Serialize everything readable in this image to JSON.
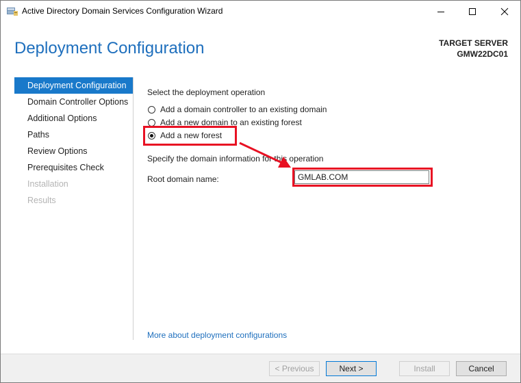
{
  "window": {
    "title": "Active Directory Domain Services Configuration Wizard"
  },
  "header": {
    "page_title": "Deployment Configuration",
    "target_label": "TARGET SERVER",
    "target_server": "GMW22DC01"
  },
  "sidebar": {
    "items": [
      {
        "label": "Deployment Configuration",
        "state": "active"
      },
      {
        "label": "Domain Controller Options",
        "state": "normal"
      },
      {
        "label": "Additional Options",
        "state": "normal"
      },
      {
        "label": "Paths",
        "state": "normal"
      },
      {
        "label": "Review Options",
        "state": "normal"
      },
      {
        "label": "Prerequisites Check",
        "state": "normal"
      },
      {
        "label": "Installation",
        "state": "disabled"
      },
      {
        "label": "Results",
        "state": "disabled"
      }
    ]
  },
  "main": {
    "operation_heading": "Select the deployment operation",
    "options": [
      {
        "label": "Add a domain controller to an existing domain",
        "checked": false
      },
      {
        "label": "Add a new domain to an existing forest",
        "checked": false
      },
      {
        "label": "Add a new forest",
        "checked": true
      }
    ],
    "domain_heading": "Specify the domain information for this operation",
    "root_domain_label": "Root domain name:",
    "root_domain_value": "GMLAB.COM",
    "more_link": "More about deployment configurations"
  },
  "footer": {
    "previous": "< Previous",
    "next": "Next >",
    "install": "Install",
    "cancel": "Cancel"
  },
  "colors": {
    "accent": "#1979ca",
    "annotation": "#e81123"
  }
}
